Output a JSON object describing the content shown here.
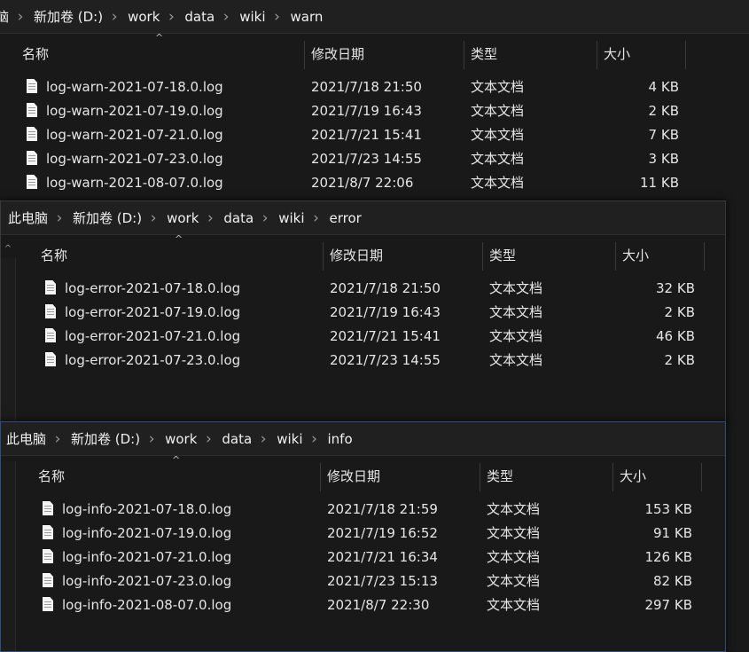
{
  "panes": [
    {
      "path": [
        "电脑",
        "新加卷 (D:)",
        "work",
        "data",
        "wiki",
        "warn"
      ],
      "headers": {
        "name": "名称",
        "date": "修改日期",
        "type": "类型",
        "size": "大小"
      },
      "files": [
        {
          "name": "log-warn-2021-07-18.0.log",
          "date": "2021/7/18 21:50",
          "type": "文本文档",
          "size": "4 KB"
        },
        {
          "name": "log-warn-2021-07-19.0.log",
          "date": "2021/7/19 16:43",
          "type": "文本文档",
          "size": "2 KB"
        },
        {
          "name": "log-warn-2021-07-21.0.log",
          "date": "2021/7/21 15:41",
          "type": "文本文档",
          "size": "7 KB"
        },
        {
          "name": "log-warn-2021-07-23.0.log",
          "date": "2021/7/23 14:55",
          "type": "文本文档",
          "size": "3 KB"
        },
        {
          "name": "log-warn-2021-08-07.0.log",
          "date": "2021/8/7 22:06",
          "type": "文本文档",
          "size": "11 KB"
        }
      ]
    },
    {
      "path": [
        "此电脑",
        "新加卷 (D:)",
        "work",
        "data",
        "wiki",
        "error"
      ],
      "headers": {
        "name": "名称",
        "date": "修改日期",
        "type": "类型",
        "size": "大小"
      },
      "files": [
        {
          "name": "log-error-2021-07-18.0.log",
          "date": "2021/7/18 21:50",
          "type": "文本文档",
          "size": "32 KB"
        },
        {
          "name": "log-error-2021-07-19.0.log",
          "date": "2021/7/19 16:43",
          "type": "文本文档",
          "size": "2 KB"
        },
        {
          "name": "log-error-2021-07-21.0.log",
          "date": "2021/7/21 15:41",
          "type": "文本文档",
          "size": "46 KB"
        },
        {
          "name": "log-error-2021-07-23.0.log",
          "date": "2021/7/23 14:55",
          "type": "文本文档",
          "size": "2 KB"
        }
      ]
    },
    {
      "path": [
        "此电脑",
        "新加卷 (D:)",
        "work",
        "data",
        "wiki",
        "info"
      ],
      "headers": {
        "name": "名称",
        "date": "修改日期",
        "type": "类型",
        "size": "大小"
      },
      "files": [
        {
          "name": "log-info-2021-07-18.0.log",
          "date": "2021/7/18 21:59",
          "type": "文本文档",
          "size": "153 KB"
        },
        {
          "name": "log-info-2021-07-19.0.log",
          "date": "2021/7/19 16:52",
          "type": "文本文档",
          "size": "91 KB"
        },
        {
          "name": "log-info-2021-07-21.0.log",
          "date": "2021/7/21 16:34",
          "type": "文本文档",
          "size": "126 KB"
        },
        {
          "name": "log-info-2021-07-23.0.log",
          "date": "2021/7/23 15:13",
          "type": "文本文档",
          "size": "82 KB"
        },
        {
          "name": "log-info-2021-08-07.0.log",
          "date": "2021/8/7 22:30",
          "type": "文本文档",
          "size": "297 KB"
        }
      ]
    }
  ],
  "icons": {
    "file": "text-file-icon",
    "chevron": "chevron-right-icon",
    "sort": "sort-ascending-icon"
  }
}
